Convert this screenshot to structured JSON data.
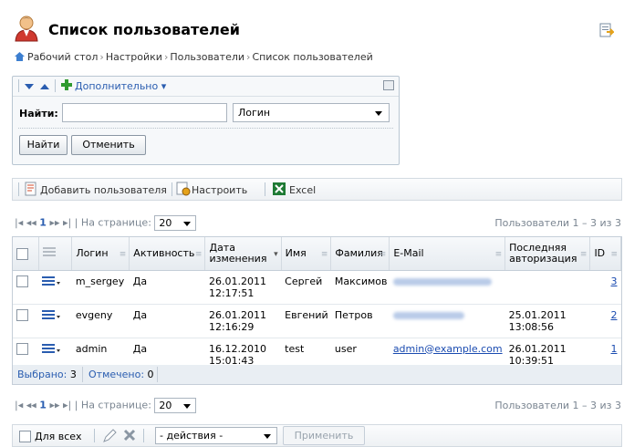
{
  "title": "Список пользователей",
  "breadcrumb": [
    "Рабочий стол",
    "Настройки",
    "Пользователи",
    "Список пользователей"
  ],
  "filter": {
    "more_label": "Дополнительно",
    "find_label": "Найти:",
    "search_value": "",
    "field_selected": "Логин",
    "find_button": "Найти",
    "cancel_button": "Отменить"
  },
  "toolbar": {
    "add_user": "Добавить пользователя",
    "configure": "Настроить",
    "excel": "Excel"
  },
  "pager": {
    "page": "1",
    "per_page_label": "| На странице:",
    "per_page": "20",
    "count_label": "Пользователи 1 – 3 из 3"
  },
  "grid": {
    "columns": [
      "Логин",
      "Активность",
      "Дата изменения",
      "Имя",
      "Фамилия",
      "E-Mail",
      "Последняя авторизация",
      "ID"
    ],
    "rows": [
      {
        "login": "m_sergey",
        "active": "Да",
        "date": "26.01.2011",
        "time": "12:17:51",
        "name": "Сергей",
        "surname": "Максимов",
        "email": "",
        "last_date": "",
        "last_time": "",
        "id": "3"
      },
      {
        "login": "evgeny",
        "active": "Да",
        "date": "26.01.2011",
        "time": "12:16:29",
        "name": "Евгений",
        "surname": "Петров",
        "email": "",
        "last_date": "25.01.2011",
        "last_time": "13:08:56",
        "id": "2"
      },
      {
        "login": "admin",
        "active": "Да",
        "date": "16.12.2010",
        "time": "15:01:43",
        "name": "test",
        "surname": "user",
        "email": "admin@example.com",
        "last_date": "26.01.2011",
        "last_time": "10:39:51",
        "id": "1"
      }
    ],
    "selected_label": "Выбрано:",
    "selected_count": "3",
    "checked_label": "Отмечено:",
    "checked_count": "0"
  },
  "bottom": {
    "for_all": "Для всех",
    "action_selected": "- действия -",
    "apply_button": "Применить"
  },
  "colors": {
    "accent": "#2a5db0",
    "border": "#c5ced8",
    "header_bg": "#e6ebf0"
  }
}
